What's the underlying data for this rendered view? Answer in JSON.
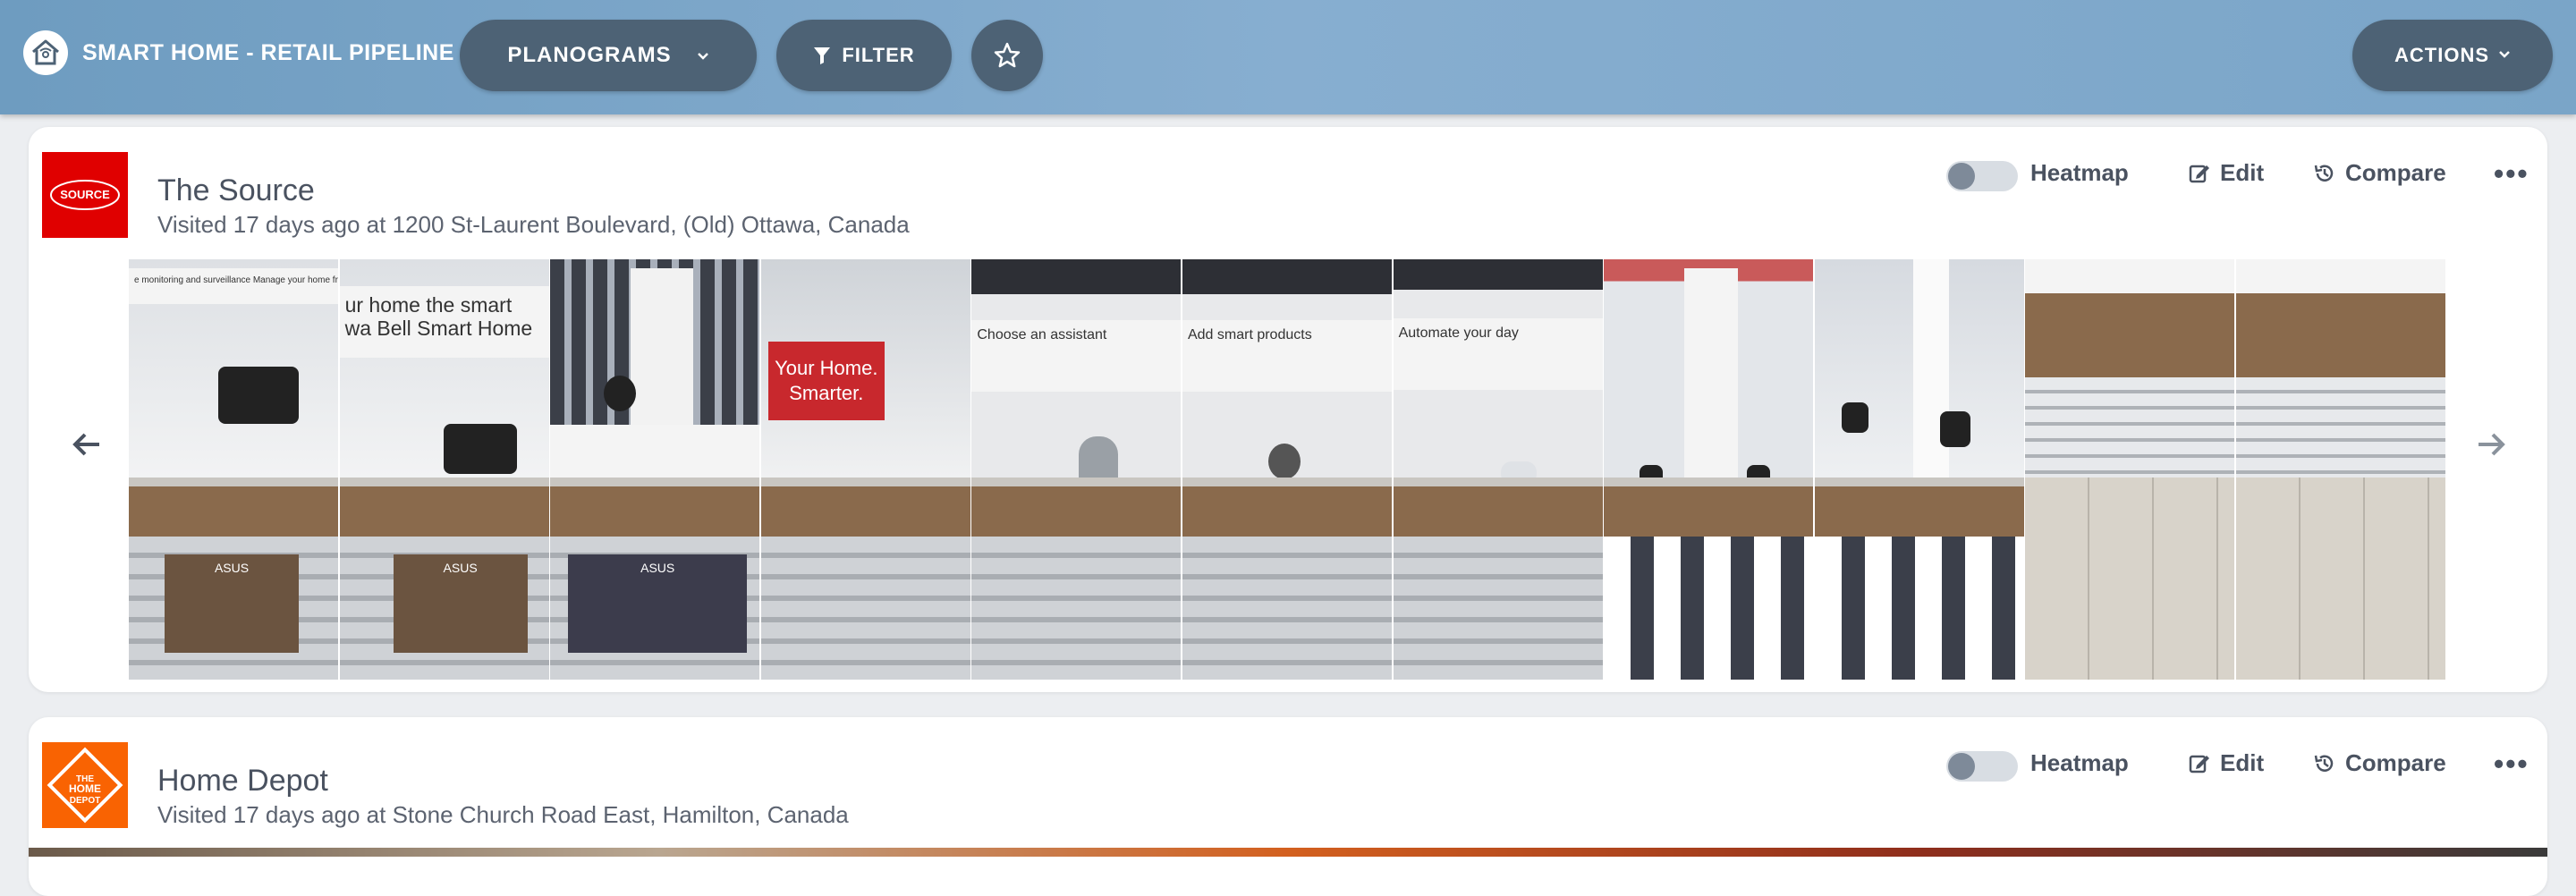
{
  "app": {
    "title": "SMART HOME - RETAIL PIPELINE",
    "logo_icon": "smart-home-logo-icon"
  },
  "toolbar": {
    "planograms_label": "PLANOGRAMS",
    "filter_label": "FILTER",
    "actions_label": "ACTIONS"
  },
  "stores": [
    {
      "name": "The Source",
      "visit": "Visited 17 days ago at 1200 St-Laurent Boulevard, (Old) Ottawa, Canada",
      "logo_color": "#e00000",
      "logo_text": "THE SOURCE",
      "controls": {
        "heatmap": "Heatmap",
        "heatmap_on": false,
        "edit": "Edit",
        "compare": "Compare"
      },
      "photos": [
        {
          "sign": "e monitoring and surveillance   Manage your home from anywhere",
          "kind": "counter"
        },
        {
          "sign": "ur home the smart wa Bell Smart Home",
          "kind": "counter"
        },
        {
          "sign": "",
          "kind": "counter"
        },
        {
          "sign": "Your Home. Smarter.",
          "kind": "red"
        },
        {
          "sign": "Choose an assistant",
          "kind": "counter"
        },
        {
          "sign": "Add smart products",
          "kind": "counter"
        },
        {
          "sign": "Automate your day",
          "kind": "counter"
        },
        {
          "sign": "",
          "kind": "counter"
        },
        {
          "sign": "",
          "kind": "counter"
        },
        {
          "sign": "",
          "kind": "floor"
        },
        {
          "sign": "",
          "kind": "floor"
        }
      ]
    },
    {
      "name": "Home Depot",
      "visit": "Visited 17 days ago at Stone Church Road East, Hamilton, Canada",
      "logo_color": "#f96302",
      "logo_text": "THE HOME DEPOT",
      "controls": {
        "heatmap": "Heatmap",
        "heatmap_on": false,
        "edit": "Edit",
        "compare": "Compare"
      }
    }
  ],
  "colors": {
    "topbar": "#7aa5c8",
    "pill": "#4d6275",
    "card": "#ffffff",
    "background": "#eceef1"
  }
}
